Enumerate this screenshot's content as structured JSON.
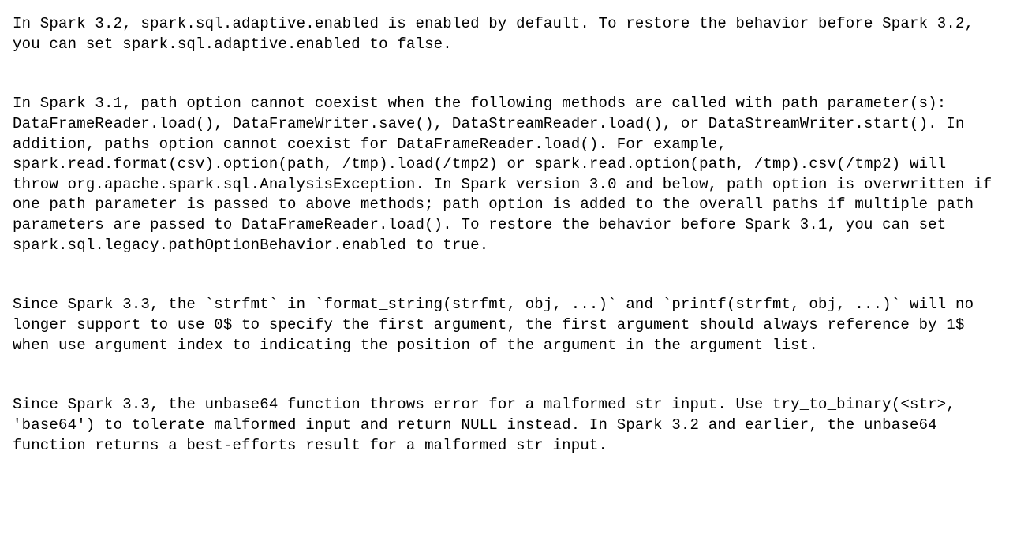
{
  "paragraphs": [
    "In Spark 3.2, spark.sql.adaptive.enabled is enabled by default. To restore the behavior before Spark 3.2,\nyou can set spark.sql.adaptive.enabled to false.",
    "In Spark 3.1, path option cannot coexist when the following methods are called with path parameter(s): DataFrameReader.load(), DataFrameWriter.save(), DataStreamReader.load(), or DataStreamWriter.start(). In addition, paths option cannot coexist for DataFrameReader.load(). For example, spark.read.format(csv).option(path, /tmp).load(/tmp2) or spark.read.option(path, /tmp).csv(/tmp2) will throw org.apache.spark.sql.AnalysisException. In Spark version 3.0 and below, path option is overwritten if one path parameter is passed to above methods; path option is added to the overall paths if multiple path parameters are passed to DataFrameReader.load(). To restore the behavior before Spark 3.1, you can set spark.sql.legacy.pathOptionBehavior.enabled to true.",
    "Since Spark 3.3, the `strfmt` in `format_string(strfmt, obj, ...)` and `printf(strfmt, obj, ...)` will no longer support to use 0$ to specify the first argument, the first argument should always reference by 1$ when use argument index to indicating the position of the argument in the argument list.",
    "Since Spark 3.3, the unbase64 function throws error for a malformed str input. Use try_to_binary(<str>, 'base64') to tolerate malformed input and return NULL instead. In Spark 3.2 and earlier, the unbase64 function returns a best-efforts result for a malformed str input."
  ]
}
